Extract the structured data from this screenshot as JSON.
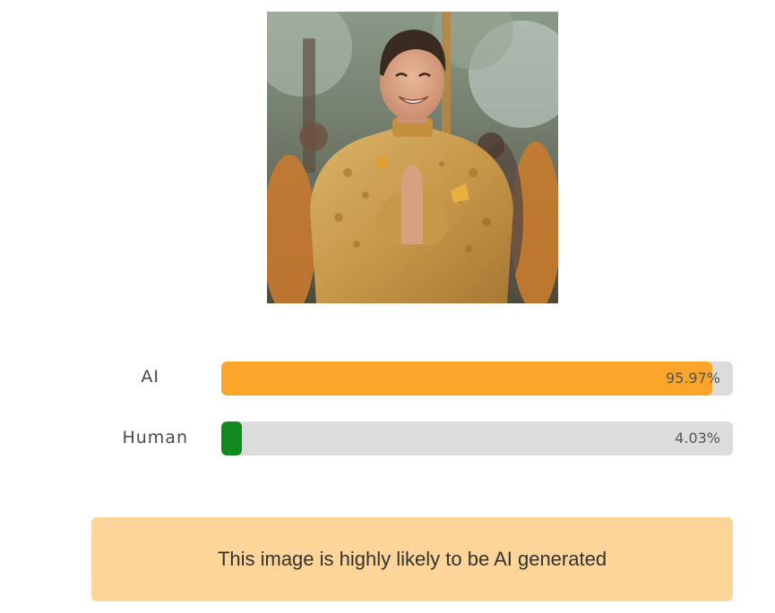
{
  "image": {
    "alt": "uploaded image preview"
  },
  "results": [
    {
      "label": "AI",
      "value_text": "95.97%",
      "fraction": 0.9597,
      "color": "#fba62a"
    },
    {
      "label": "Human",
      "value_text": "4.03%",
      "fraction": 0.0403,
      "color": "#138a1f"
    }
  ],
  "verdict": {
    "text": "This image is highly likely to be AI generated"
  },
  "colors": {
    "track": "#dcdcdc",
    "verdict_background": "#fdd598"
  }
}
